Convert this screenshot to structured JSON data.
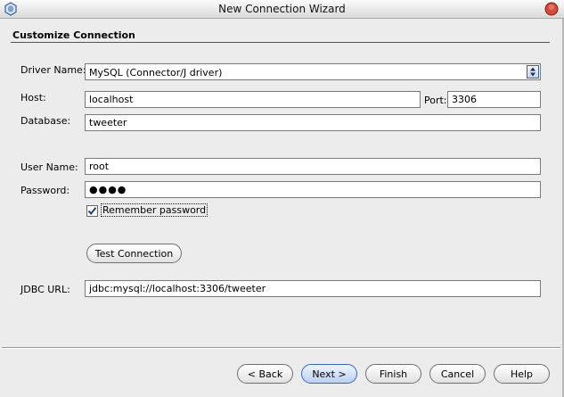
{
  "window": {
    "title": "New Connection Wizard"
  },
  "section": {
    "title": "Customize Connection"
  },
  "form": {
    "driver_label": "Driver Name:",
    "driver_value": "MySQL (Connector/J driver)",
    "host_label": "Host:",
    "host_value": "localhost",
    "port_label": "Port:",
    "port_value": "3306",
    "database_label": "Database:",
    "database_value": "tweeter",
    "username_label": "User Name:",
    "username_value": "root",
    "password_label": "Password:",
    "password_value": "●●●●",
    "remember_label": "Remember password",
    "remember_checked": true,
    "test_button": "Test Connection",
    "jdbc_label": "JDBC URL:",
    "jdbc_value": "jdbc:mysql://localhost:3306/tweeter"
  },
  "footer": {
    "back": "< Back",
    "next": "Next >",
    "finish": "Finish",
    "cancel": "Cancel",
    "help": "Help"
  },
  "icons": {
    "app": "wizard-app-icon",
    "close": "close-icon",
    "spinner": "up-down-arrows-icon",
    "check": "checkmark-icon"
  },
  "colors": {
    "accent": "#3a66b8",
    "close": "#c0392b"
  }
}
